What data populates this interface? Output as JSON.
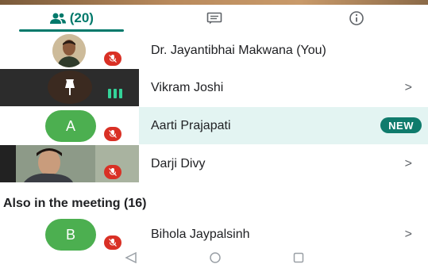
{
  "tabs": {
    "people_count": "(20)",
    "people_icon": "people-icon",
    "chat_icon": "chat-icon",
    "info_icon": "info-icon"
  },
  "participants": [
    {
      "name": "Dr. Jayantibhai Makwana (You)",
      "mic": "muted",
      "has_chevron": false
    },
    {
      "name": "Vikram Joshi",
      "mic": "speaking",
      "has_chevron": true,
      "chevron": ">"
    },
    {
      "name": "Aarti Prajapati",
      "avatar_letter": "A",
      "mic": "muted",
      "badge": "NEW",
      "highlighted": true
    },
    {
      "name": "Darji Divy",
      "mic": "muted",
      "has_chevron": true,
      "chevron": ">"
    }
  ],
  "also_in_meeting": {
    "title": "Also in the meeting (16)",
    "items": [
      {
        "name": "Bihola Jaypalsinh",
        "avatar_letter": "B",
        "mic": "muted",
        "chevron": ">"
      }
    ]
  },
  "colors": {
    "accent": "#00796b",
    "highlight_row": "#e3f4f2",
    "mic_off": "#d93025",
    "avatar_green": "#4caf50",
    "badge": "#0f7b6c"
  },
  "nav": {
    "back_icon": "back-triangle-icon",
    "home_icon": "home-circle-icon",
    "recents_icon": "recents-square-icon"
  }
}
